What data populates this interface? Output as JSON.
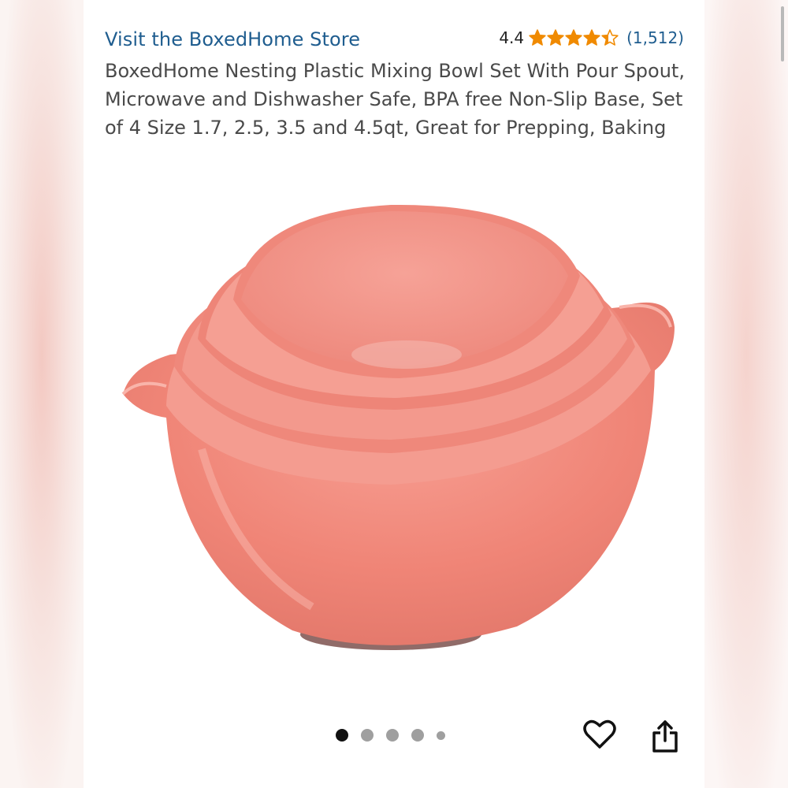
{
  "product": {
    "store_link": "Visit the BoxedHome Store",
    "rating": "4.4",
    "stars": 4.4,
    "review_count": "(1,512)",
    "title": "BoxedHome Nesting Plastic Mixing Bowl Set With Pour Spout, Microwave and Dishwasher Safe, BPA free Non-Slip Base, Set of 4 Size 1.7, 2.5, 3.5 and 4.5qt, Great for Prepping, Baking"
  },
  "gallery": {
    "image_name": "product-photo-nesting-bowls",
    "total_images": 5,
    "active_index": 0
  },
  "actions": {
    "favorite_icon": "heart-icon",
    "share_icon": "share-icon"
  },
  "colors": {
    "link": "#1f5d8f",
    "star": "#f08a00",
    "bowl": "#f08a80"
  }
}
